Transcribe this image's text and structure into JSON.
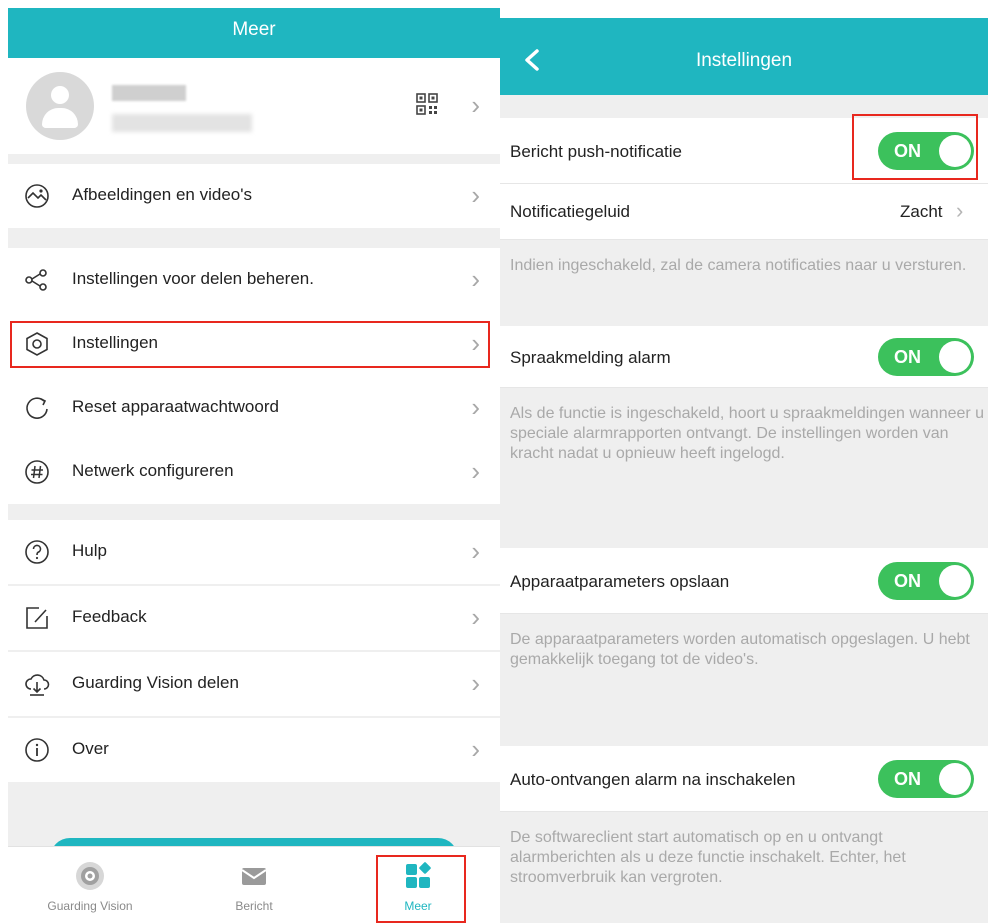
{
  "colors": {
    "accent": "#1fb6c0",
    "toggle_on": "#3cc15c",
    "highlight": "#e8281e"
  },
  "left": {
    "header": {
      "title": "Meer"
    },
    "profile": {
      "qr_icon": "qr-code-icon"
    },
    "menu": [
      {
        "label": "Afbeeldingen en video's",
        "icon": "gallery-icon"
      },
      {
        "label": "Instellingen voor delen beheren.",
        "icon": "share-icon"
      },
      {
        "label": "Instellingen",
        "icon": "settings-hexagon-icon"
      },
      {
        "label": "Reset apparaatwachtwoord",
        "icon": "reset-icon"
      },
      {
        "label": "Netwerk configureren",
        "icon": "hashtag-icon"
      },
      {
        "label": "Hulp",
        "icon": "help-icon"
      },
      {
        "label": "Feedback",
        "icon": "feedback-icon"
      },
      {
        "label": "Guarding Vision delen",
        "icon": "cloud-download-icon"
      },
      {
        "label": "Over",
        "icon": "info-icon"
      }
    ],
    "tabs": [
      {
        "label": "Guarding Vision",
        "icon": "camera-icon"
      },
      {
        "label": "Bericht",
        "icon": "mail-icon"
      },
      {
        "label": "Meer",
        "icon": "grid-icon"
      }
    ]
  },
  "right": {
    "header": {
      "title": "Instellingen"
    },
    "push": {
      "label": "Bericht push-notificatie",
      "toggle": "ON"
    },
    "sound": {
      "label": "Notificatiegeluid",
      "value": "Zacht"
    },
    "push_note": "Indien ingeschakeld, zal de camera notificaties naar u versturen.",
    "voice": {
      "label": "Spraakmelding alarm",
      "toggle": "ON"
    },
    "voice_note": "Als de functie is ingeschakeld, hoort u spraakmeldingen wanneer u speciale alarmrapporten ontvangt. De instellingen worden van kracht nadat u opnieuw heeft ingelogd.",
    "params": {
      "label": "Apparaatparameters opslaan",
      "toggle": "ON"
    },
    "params_note": "De apparaatparameters worden automatisch opgeslagen. U hebt gemakkelijk toegang tot de video's.",
    "auto": {
      "label": "Auto-ontvangen alarm na inschakelen",
      "toggle": "ON"
    },
    "auto_note": "De softwareclient start automatisch op en u ontvangt alarmberichten als u deze functie inschakelt. Echter, het stroomverbruik kan vergroten."
  }
}
